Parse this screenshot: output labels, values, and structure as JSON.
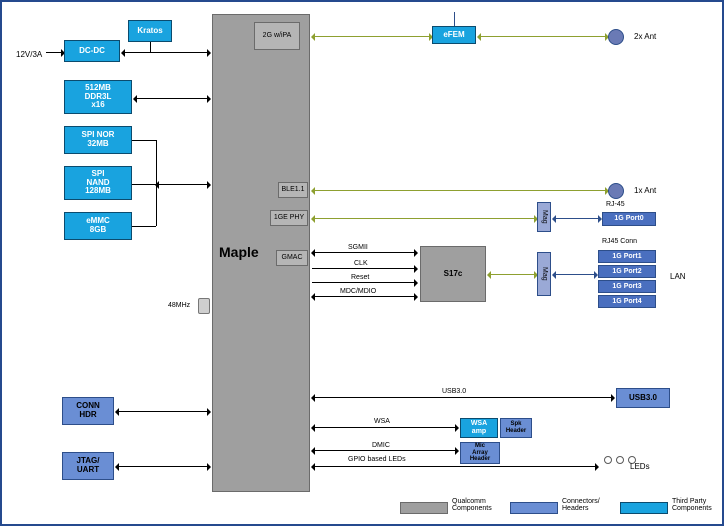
{
  "power_in": "12V/3A",
  "left": {
    "dc_dc": "DC-DC",
    "kratos": "Kratos",
    "ddr": "512MB\nDDR3L\nx16",
    "spi_nor": "SPI NOR\n32MB",
    "spi_nand": "SPI\nNAND\n128MB",
    "emmc": "eMMC\n8GB",
    "conn_hdr": "CONN\nHDR",
    "jtag": "JTAG/\nUART"
  },
  "maple": {
    "name": "Maple",
    "blocks": {
      "2g": "2G w/iPA",
      "ble": "BLE1.1",
      "phy": "1GE PHY",
      "gmac": "GMAC"
    }
  },
  "bus": {
    "sgmii": "SGMII",
    "clk": "CLK",
    "reset": "Reset",
    "mdc": "MDC/MDIO",
    "usb": "USB3.0",
    "wsa": "WSA",
    "dmic": "DMIC",
    "gpio_led": "GPIO based LEDs"
  },
  "clk_src": "48MHz",
  "right": {
    "efem": "eFEM",
    "ant2": "2x Ant",
    "ant1": "1x Ant",
    "mag1": "Mag",
    "mag2": "Mag",
    "rj45": "RJ-45",
    "port0": "1G Port0",
    "switch": "S17c",
    "rj45_conn": "RJ45 Conn",
    "ports": [
      "1G Port1",
      "1G Port2",
      "1G Port3",
      "1G Port4"
    ],
    "lan": "LAN",
    "usb": "USB3.0",
    "wsa_amp": "WSA\namp",
    "spk_hdr": "Spk\nHeader",
    "mic_hdr": "Mic\nArray\nHeader",
    "leds": "LEDs"
  },
  "legend": {
    "qc": "Qualcomm\nComponents",
    "conn": "Connectors/\nHeaders",
    "tp": "Third Party\nComponents"
  }
}
